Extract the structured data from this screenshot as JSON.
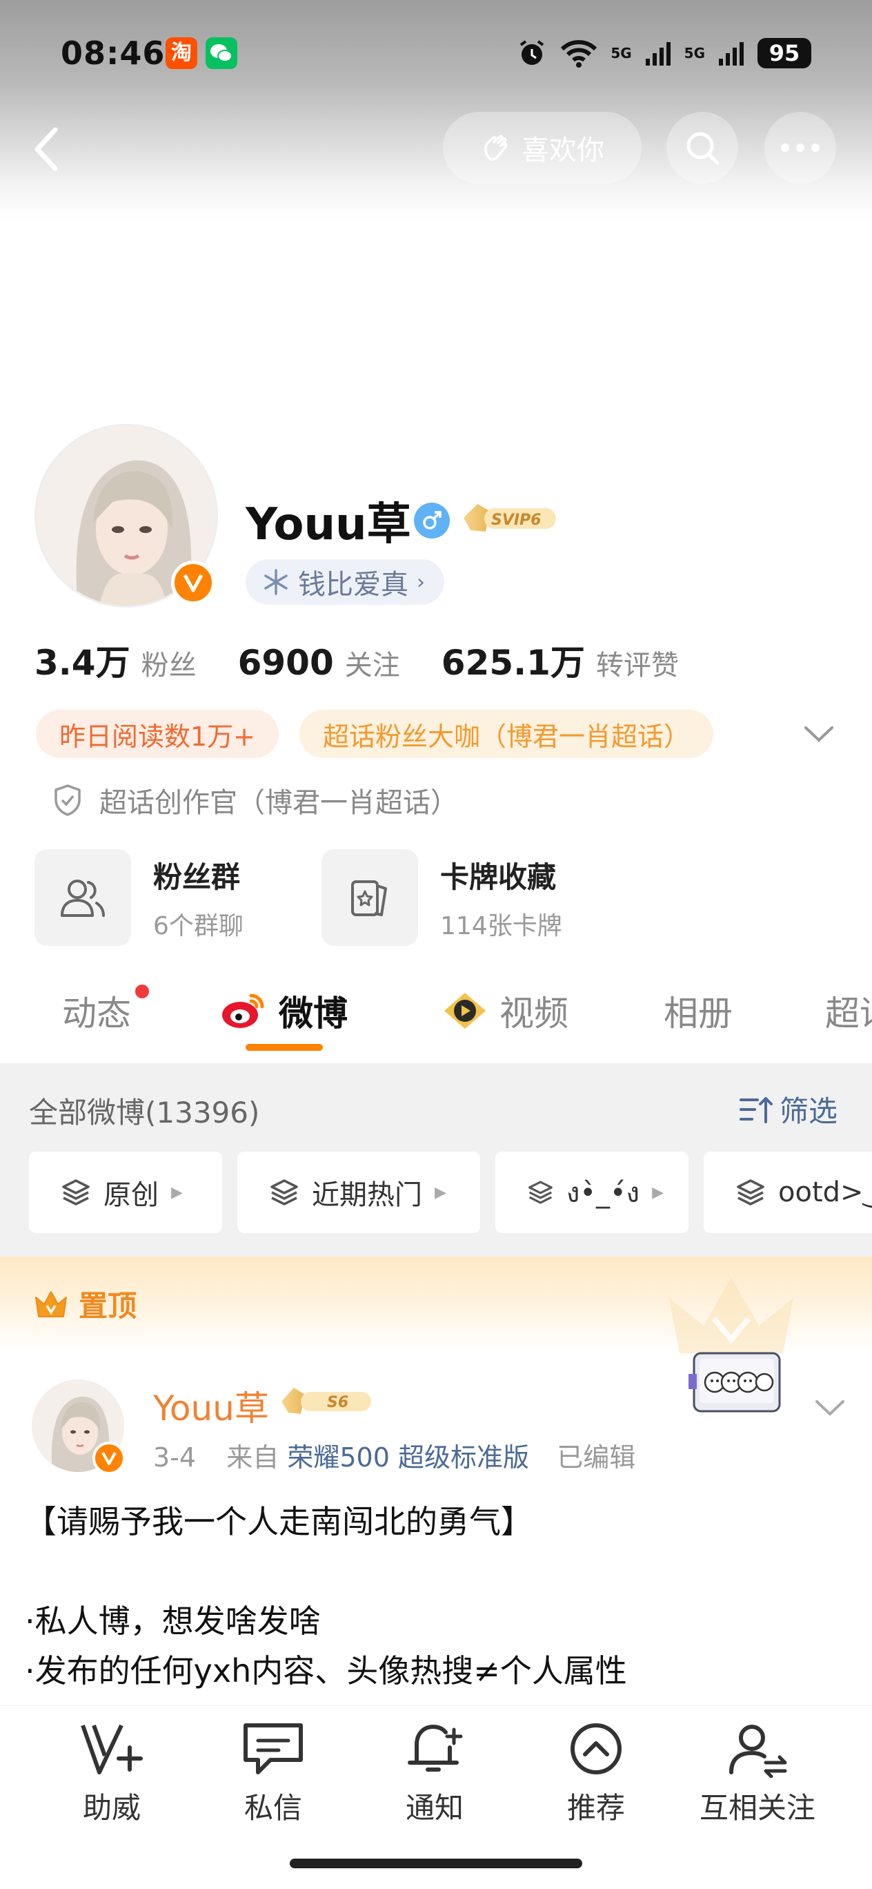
{
  "status_bar": {
    "time": "08:46",
    "taobao_icon": "淘",
    "wechat_icon": "wechat-icon",
    "network_1": "5G",
    "network_2": "5G",
    "battery": "95"
  },
  "header": {
    "like_button": "喜欢你",
    "icons": [
      "back-icon",
      "search-icon",
      "more-icon"
    ]
  },
  "profile": {
    "username": "Youu草",
    "svip_badge": "SVIP6",
    "group_chip": "钱比爱真",
    "stats": [
      {
        "value": "3.4万",
        "label": "粉丝"
      },
      {
        "value": "6900",
        "label": "关注"
      },
      {
        "value": "625.1万",
        "label": "转评赞"
      }
    ],
    "tags": [
      "昨日阅读数1万+",
      "超话粉丝大咖（博君一肖超话）"
    ],
    "creator": "超话创作官（博君一肖超话）",
    "entries": [
      {
        "title": "粉丝群",
        "sub": "6个群聊"
      },
      {
        "title": "卡牌收藏",
        "sub": "114张卡牌"
      }
    ]
  },
  "tabs": [
    "动态",
    "微博",
    "视频",
    "相册",
    "超话"
  ],
  "filter": {
    "all_weibo": "全部微博(13396)",
    "filter_label": "筛选",
    "chips": [
      "原创",
      "近期热门",
      "ง•̀_•́ง",
      "ootd>‿"
    ]
  },
  "pinned": {
    "label": "置顶",
    "author": "Youu草",
    "level_badge": "S6",
    "date": "3-4",
    "from": "来自",
    "source": "荣耀500 超级标准版",
    "edited": "已编辑",
    "body": "【请赐予我一个人走南闯北的勇气】\n\n·私人博，想发啥发啥\n·发布的任何yxh内容、头像热搜≠个人属性"
  },
  "bottom_nav": [
    "助威",
    "私信",
    "通知",
    "推荐",
    "互相关注"
  ],
  "colors": {
    "accent": "#ff8200",
    "link": "#4b6a96",
    "tag_red": "#f06a32",
    "tag_orange": "#f29a2e"
  }
}
